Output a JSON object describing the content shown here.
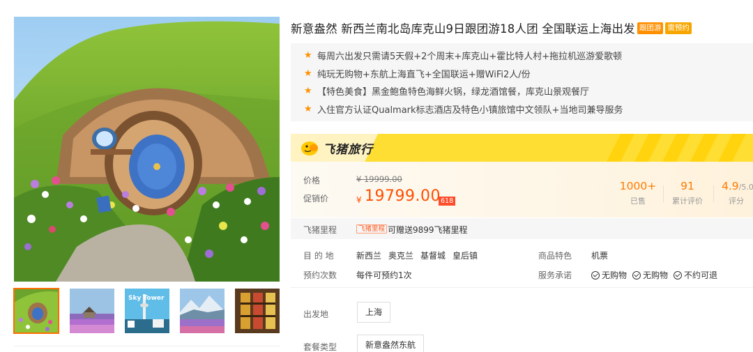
{
  "product": {
    "title": "新意盎然 新西兰南北岛库克山9日跟团游18人团 全国联运上海出发",
    "tags": [
      "跟团游",
      "需预约"
    ]
  },
  "highlights": [
    "每周六出发只需请5天假+2个周末+库克山+霍比特人村+拖拉机巡游爱歌顿",
    "纯玩无购物+东航上海直飞+全国联运+赠WiFi2人/份",
    "【特色美食】黑金鲍鱼特色海鲜火锅，绿龙酒馆餐，库克山景观餐厅",
    "入住官方认证Qualmark标志酒店及特色小镇旅馆中文领队+当地司兼导服务"
  ],
  "brand": {
    "name": "飞猪旅行"
  },
  "price": {
    "label_price": "价格",
    "original": "¥ 19999.00",
    "label_sale": "促销价",
    "currency": "¥",
    "current": "19799.00",
    "badge": "618"
  },
  "stats": [
    {
      "value": "1000+",
      "label": "已售"
    },
    {
      "value": "91",
      "label": "累计评价"
    },
    {
      "value": "4.9",
      "suffix": "/5.0",
      "label": "评分"
    }
  ],
  "mileage": {
    "label": "飞猪里程",
    "badge": "飞猪里程",
    "text": "可赠送9899飞猪里程"
  },
  "info": {
    "destination_label": "目 的 地",
    "destinations": [
      "新西兰",
      "奥克兰",
      "基督城",
      "皇后镇"
    ],
    "feature_label": "商品特色",
    "feature_value": "机票",
    "booking_label": "预约次数",
    "booking_value": "每件可预约1次",
    "service_label": "服务承诺",
    "services": [
      "无购物",
      "无购物",
      "不约可退"
    ]
  },
  "options": {
    "departure_label": "出发地",
    "departure_value": "上海",
    "package_label": "套餐类型",
    "package_value": "新意盎然东航"
  },
  "gallery": {
    "thumbnails": [
      "hobbit-hole",
      "church-lupins",
      "sky-tower",
      "mountain-lake",
      "stained-glass"
    ],
    "sky_tower_text": "Sky Tower"
  },
  "colors": {
    "accent_orange": "#ff4e00",
    "brand_yellow": "#ffde33",
    "star": "#ff9000"
  }
}
